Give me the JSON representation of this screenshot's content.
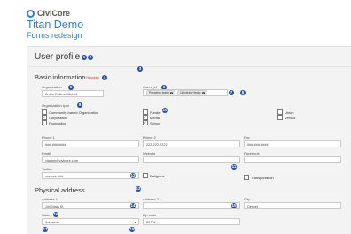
{
  "brand": {
    "logo_text": "CiviCore",
    "app_title": "Titan Demo",
    "app_subtitle": "Forms redesign"
  },
  "page": {
    "title": "User profile"
  },
  "markers": [
    "1",
    "2",
    "3",
    "4",
    "5",
    "6",
    "7",
    "8",
    "9",
    "10",
    "11",
    "12",
    "13",
    "14",
    "15",
    "16",
    "17",
    "18"
  ],
  "basic": {
    "title": "Basic information",
    "required_note": "* Required",
    "organization": {
      "label": "Organization",
      "value": "Anton Collins Mitchell"
    },
    "users_id": {
      "label": "Users_id*",
      "chips": [
        "Princeton tester",
        "University tester"
      ]
    },
    "org_type": {
      "label": "Organization type",
      "options": [
        {
          "label": "Community-based Organization",
          "checked": ""
        },
        {
          "label": "Corporation",
          "checked": "✓"
        },
        {
          "label": "Foundation",
          "checked": ""
        },
        {
          "label": "Funder",
          "checked": ""
        },
        {
          "label": "Media",
          "checked": "✓"
        },
        {
          "label": "School",
          "checked": "✓"
        },
        {
          "label": "Union",
          "checked": ""
        },
        {
          "label": "Vendor",
          "checked": ""
        }
      ]
    },
    "phone1": {
      "label": "Phone 1",
      "value": "###-###-####"
    },
    "phone2": {
      "label": "Phone 2",
      "value": "222-222-2222"
    },
    "fax": {
      "label": "Fax",
      "value": "###-###-####"
    },
    "email": {
      "label": "Email",
      "value": "clayton@civicore.com"
    },
    "website": {
      "label": "Website",
      "value": ""
    },
    "facebook": {
      "label": "Facebook",
      "value": ""
    },
    "twitter": {
      "label": "Twitter",
      "value": "xxx-xxx-###"
    },
    "religious": {
      "label": "Religious",
      "checked": ""
    },
    "transportation": {
      "label": "Transportation",
      "checked": ""
    }
  },
  "address": {
    "title": "Physical address",
    "address1": {
      "label": "Address 1",
      "value": "100 Main St"
    },
    "address2": {
      "label": "Address 2",
      "value": ""
    },
    "city": {
      "label": "City",
      "value": "Denver"
    },
    "state": {
      "label": "State",
      "value": "Arkansas"
    },
    "zip": {
      "label": "Zip code",
      "value": "80204"
    }
  }
}
